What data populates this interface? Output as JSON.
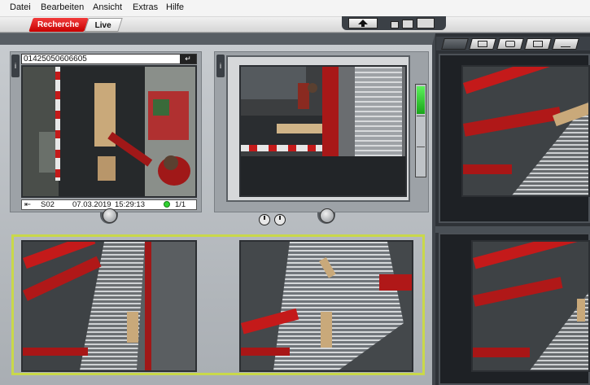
{
  "menu": {
    "items": [
      "Datei",
      "Bearbeiten",
      "Ansicht",
      "Extras",
      "Hilfe"
    ]
  },
  "toolbar": {
    "recherche_label": "Recherche",
    "live_label": "Live"
  },
  "camera1": {
    "address_value": "01425050606605",
    "info_label": "i",
    "status": {
      "channel": "S02",
      "date": "07.03.2019",
      "time": "15:29:13",
      "page": "1/1"
    }
  },
  "camera2": {
    "info_label": "i"
  },
  "colors": {
    "accent_red": "#d90000",
    "highlight": "#c9d84a",
    "status_green": "#2fd12f",
    "conveyor_red": "#c41a1a"
  },
  "icons": [
    "enter-arrow-icon",
    "logout-icon",
    "clock-icon",
    "clock-partial-icon",
    "upload-arrow-icon",
    "grid-icon",
    "cube-icon",
    "map-icon",
    "list-icon"
  ]
}
